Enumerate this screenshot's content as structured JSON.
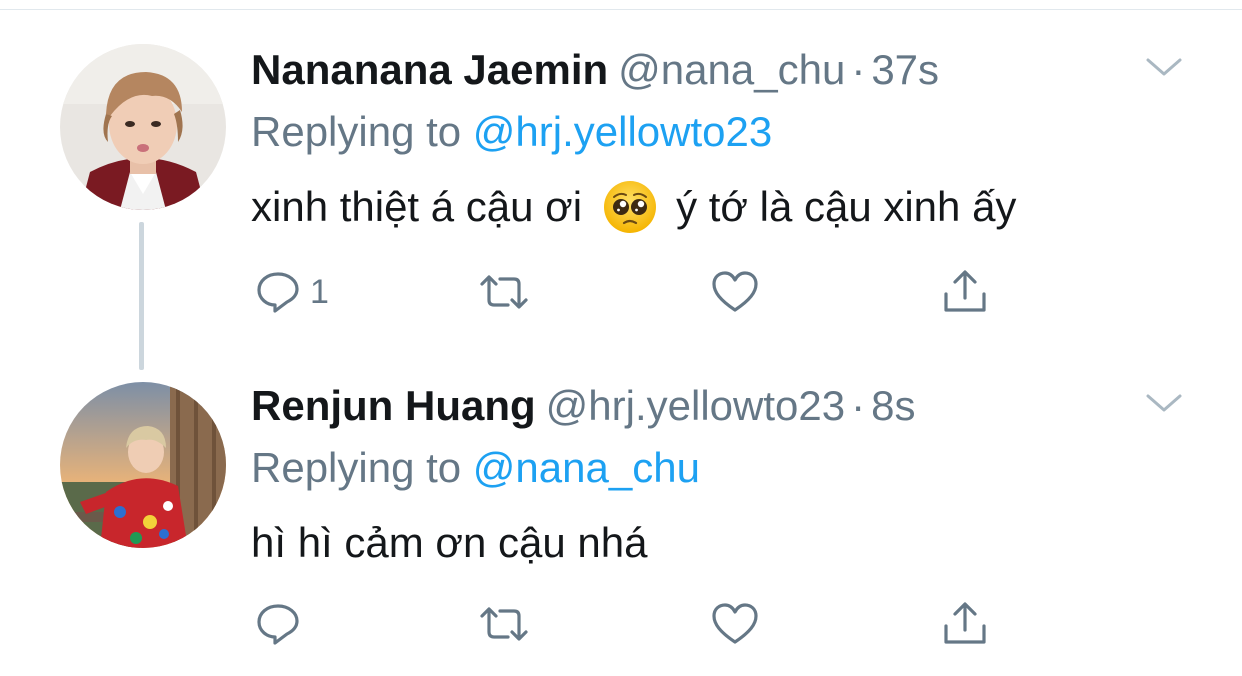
{
  "tweets": [
    {
      "display_name": "Nananana Jaemin",
      "handle": "@nana_chu",
      "separator": "·",
      "time": "37s",
      "replying_prefix": "Replying to",
      "replying_to": "@hrj.yellowto23",
      "text_before_emoji": "xinh thiệt á cậu ơi",
      "emoji": "pleading-face",
      "text_after_emoji": "ý tớ là cậu xinh ấy",
      "reply_count": "1",
      "icons": [
        "reply-icon",
        "retweet-icon",
        "like-icon",
        "share-icon",
        "chevron-down-icon"
      ]
    },
    {
      "display_name": "Renjun Huang",
      "handle": "@hrj.yellowto23",
      "separator": "·",
      "time": "8s",
      "replying_prefix": "Replying to",
      "replying_to": "@nana_chu",
      "text": "hì hì cảm ơn cậu nhá",
      "reply_count": "",
      "icons": [
        "reply-icon",
        "retweet-icon",
        "like-icon",
        "share-icon",
        "chevron-down-icon"
      ]
    }
  ],
  "colors": {
    "primary_text": "#14171a",
    "secondary_text": "#657786",
    "accent": "#1da1f2",
    "thread_line": "#ccd6dd",
    "divider": "#e1e8ed"
  }
}
